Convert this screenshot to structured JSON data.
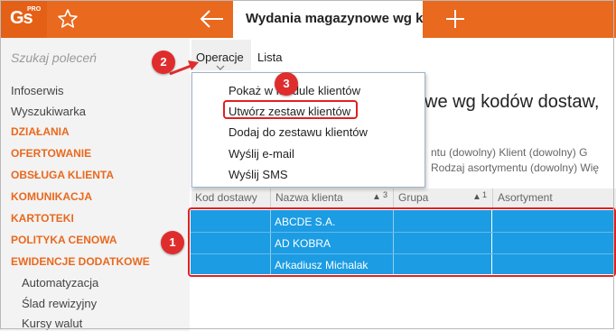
{
  "app": {
    "logo": "Gs",
    "logo_sup": "PRO",
    "tab_title": "Wydania magazynowe wg kodów dostaw, klientów"
  },
  "icons": {
    "favorite": "star-outline-icon",
    "back": "arrow-left-icon",
    "new_tab": "plus-icon"
  },
  "colors": {
    "accent": "#e9691e",
    "selection": "#1b9ce3",
    "annotation": "#df2d2d"
  },
  "sidebar": {
    "search_placeholder": "Szukaj poleceń",
    "items": [
      {
        "label": "Infoserwis"
      },
      {
        "label": "Wyszukiwarka"
      },
      {
        "label": "DZIAŁANIA"
      },
      {
        "label": "OFERTOWANIE"
      },
      {
        "label": "OBSŁUGA KLIENTA"
      },
      {
        "label": "KOMUNIKACJA"
      },
      {
        "label": "KARTOTEKI"
      },
      {
        "label": "POLITYKA CENOWA"
      },
      {
        "label": "EWIDENCJE DODATKOWE"
      },
      {
        "label": "Automatyzacja"
      },
      {
        "label": "Ślad rewizyjny"
      },
      {
        "label": "Kursy walut"
      }
    ]
  },
  "menubar": {
    "operacje": "Operacje",
    "lista": "Lista"
  },
  "dropdown": {
    "items": [
      {
        "label": "Pokaż w module klientów"
      },
      {
        "label": "Utwórz zestaw klientów"
      },
      {
        "label": "Dodaj do zestawu klientów"
      },
      {
        "label": "Wyślij e-mail"
      },
      {
        "label": "Wyślij SMS"
      }
    ]
  },
  "page": {
    "title": "we wg kodów dostaw,",
    "filter_line1": "ntu (dowolny)   Klient (dowolny)   G",
    "filter_line2": "Rodzaj asortymentu (dowolny)   Wię"
  },
  "grid": {
    "columns": [
      {
        "label": "Kod dostawy",
        "sort": ""
      },
      {
        "label": "Nazwa klienta",
        "sort": "3"
      },
      {
        "label": "Grupa",
        "sort": "1"
      },
      {
        "label": "Asortyment",
        "sort": ""
      }
    ],
    "rows": [
      {
        "kod": "",
        "klient": "ABCDE S.A.",
        "grupa": "",
        "asortyment": ""
      },
      {
        "kod": "",
        "klient": "AD KOBRA",
        "grupa": "",
        "asortyment": ""
      },
      {
        "kod": "",
        "klient": "Arkadiusz Michalak",
        "grupa": "",
        "asortyment": ""
      }
    ]
  },
  "annotations": {
    "badge1": "1",
    "badge2": "2",
    "badge3": "3"
  }
}
